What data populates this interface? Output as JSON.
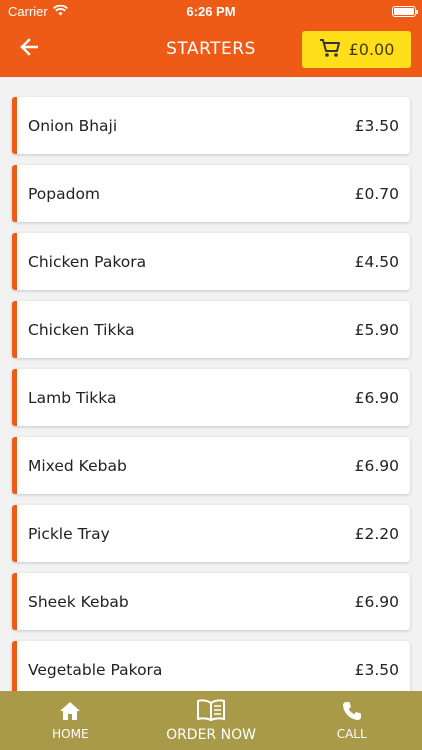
{
  "status": {
    "carrier": "Carrier",
    "time": "6:26 PM"
  },
  "header": {
    "title": "STARTERS",
    "cart_total": "£0.00"
  },
  "items": [
    {
      "name": "Onion Bhaji",
      "price": "£3.50"
    },
    {
      "name": "Popadom",
      "price": "£0.70"
    },
    {
      "name": "Chicken Pakora",
      "price": "£4.50"
    },
    {
      "name": "Chicken Tikka",
      "price": "£5.90"
    },
    {
      "name": "Lamb Tikka",
      "price": "£6.90"
    },
    {
      "name": "Mixed Kebab",
      "price": "£6.90"
    },
    {
      "name": "Pickle Tray",
      "price": "£2.20"
    },
    {
      "name": "Sheek Kebab",
      "price": "£6.90"
    },
    {
      "name": "Vegetable Pakora",
      "price": "£3.50"
    }
  ],
  "tabs": [
    {
      "label": "HOME",
      "icon": "home-icon"
    },
    {
      "label": "ORDER NOW",
      "icon": "menu-book-icon"
    },
    {
      "label": "CALL",
      "icon": "phone-icon"
    }
  ],
  "colors": {
    "primary": "#ee5b17",
    "cart": "#ffde1a",
    "tabbar": "#a89a49"
  }
}
